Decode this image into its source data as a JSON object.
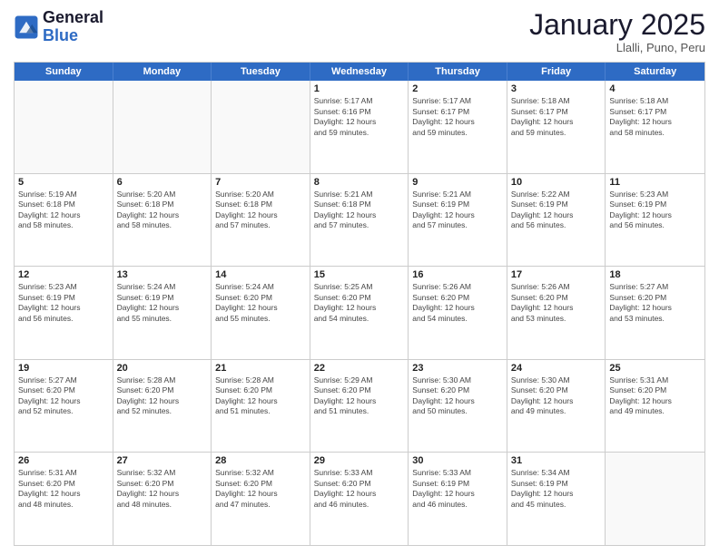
{
  "logo": {
    "line1": "General",
    "line2": "Blue"
  },
  "title": "January 2025",
  "subtitle": "Llalli, Puno, Peru",
  "weekdays": [
    "Sunday",
    "Monday",
    "Tuesday",
    "Wednesday",
    "Thursday",
    "Friday",
    "Saturday"
  ],
  "weeks": [
    [
      {
        "day": "",
        "info": ""
      },
      {
        "day": "",
        "info": ""
      },
      {
        "day": "",
        "info": ""
      },
      {
        "day": "1",
        "info": "Sunrise: 5:17 AM\nSunset: 6:16 PM\nDaylight: 12 hours\nand 59 minutes."
      },
      {
        "day": "2",
        "info": "Sunrise: 5:17 AM\nSunset: 6:17 PM\nDaylight: 12 hours\nand 59 minutes."
      },
      {
        "day": "3",
        "info": "Sunrise: 5:18 AM\nSunset: 6:17 PM\nDaylight: 12 hours\nand 59 minutes."
      },
      {
        "day": "4",
        "info": "Sunrise: 5:18 AM\nSunset: 6:17 PM\nDaylight: 12 hours\nand 58 minutes."
      }
    ],
    [
      {
        "day": "5",
        "info": "Sunrise: 5:19 AM\nSunset: 6:18 PM\nDaylight: 12 hours\nand 58 minutes."
      },
      {
        "day": "6",
        "info": "Sunrise: 5:20 AM\nSunset: 6:18 PM\nDaylight: 12 hours\nand 58 minutes."
      },
      {
        "day": "7",
        "info": "Sunrise: 5:20 AM\nSunset: 6:18 PM\nDaylight: 12 hours\nand 57 minutes."
      },
      {
        "day": "8",
        "info": "Sunrise: 5:21 AM\nSunset: 6:18 PM\nDaylight: 12 hours\nand 57 minutes."
      },
      {
        "day": "9",
        "info": "Sunrise: 5:21 AM\nSunset: 6:19 PM\nDaylight: 12 hours\nand 57 minutes."
      },
      {
        "day": "10",
        "info": "Sunrise: 5:22 AM\nSunset: 6:19 PM\nDaylight: 12 hours\nand 56 minutes."
      },
      {
        "day": "11",
        "info": "Sunrise: 5:23 AM\nSunset: 6:19 PM\nDaylight: 12 hours\nand 56 minutes."
      }
    ],
    [
      {
        "day": "12",
        "info": "Sunrise: 5:23 AM\nSunset: 6:19 PM\nDaylight: 12 hours\nand 56 minutes."
      },
      {
        "day": "13",
        "info": "Sunrise: 5:24 AM\nSunset: 6:19 PM\nDaylight: 12 hours\nand 55 minutes."
      },
      {
        "day": "14",
        "info": "Sunrise: 5:24 AM\nSunset: 6:20 PM\nDaylight: 12 hours\nand 55 minutes."
      },
      {
        "day": "15",
        "info": "Sunrise: 5:25 AM\nSunset: 6:20 PM\nDaylight: 12 hours\nand 54 minutes."
      },
      {
        "day": "16",
        "info": "Sunrise: 5:26 AM\nSunset: 6:20 PM\nDaylight: 12 hours\nand 54 minutes."
      },
      {
        "day": "17",
        "info": "Sunrise: 5:26 AM\nSunset: 6:20 PM\nDaylight: 12 hours\nand 53 minutes."
      },
      {
        "day": "18",
        "info": "Sunrise: 5:27 AM\nSunset: 6:20 PM\nDaylight: 12 hours\nand 53 minutes."
      }
    ],
    [
      {
        "day": "19",
        "info": "Sunrise: 5:27 AM\nSunset: 6:20 PM\nDaylight: 12 hours\nand 52 minutes."
      },
      {
        "day": "20",
        "info": "Sunrise: 5:28 AM\nSunset: 6:20 PM\nDaylight: 12 hours\nand 52 minutes."
      },
      {
        "day": "21",
        "info": "Sunrise: 5:28 AM\nSunset: 6:20 PM\nDaylight: 12 hours\nand 51 minutes."
      },
      {
        "day": "22",
        "info": "Sunrise: 5:29 AM\nSunset: 6:20 PM\nDaylight: 12 hours\nand 51 minutes."
      },
      {
        "day": "23",
        "info": "Sunrise: 5:30 AM\nSunset: 6:20 PM\nDaylight: 12 hours\nand 50 minutes."
      },
      {
        "day": "24",
        "info": "Sunrise: 5:30 AM\nSunset: 6:20 PM\nDaylight: 12 hours\nand 49 minutes."
      },
      {
        "day": "25",
        "info": "Sunrise: 5:31 AM\nSunset: 6:20 PM\nDaylight: 12 hours\nand 49 minutes."
      }
    ],
    [
      {
        "day": "26",
        "info": "Sunrise: 5:31 AM\nSunset: 6:20 PM\nDaylight: 12 hours\nand 48 minutes."
      },
      {
        "day": "27",
        "info": "Sunrise: 5:32 AM\nSunset: 6:20 PM\nDaylight: 12 hours\nand 48 minutes."
      },
      {
        "day": "28",
        "info": "Sunrise: 5:32 AM\nSunset: 6:20 PM\nDaylight: 12 hours\nand 47 minutes."
      },
      {
        "day": "29",
        "info": "Sunrise: 5:33 AM\nSunset: 6:20 PM\nDaylight: 12 hours\nand 46 minutes."
      },
      {
        "day": "30",
        "info": "Sunrise: 5:33 AM\nSunset: 6:19 PM\nDaylight: 12 hours\nand 46 minutes."
      },
      {
        "day": "31",
        "info": "Sunrise: 5:34 AM\nSunset: 6:19 PM\nDaylight: 12 hours\nand 45 minutes."
      },
      {
        "day": "",
        "info": ""
      }
    ]
  ]
}
